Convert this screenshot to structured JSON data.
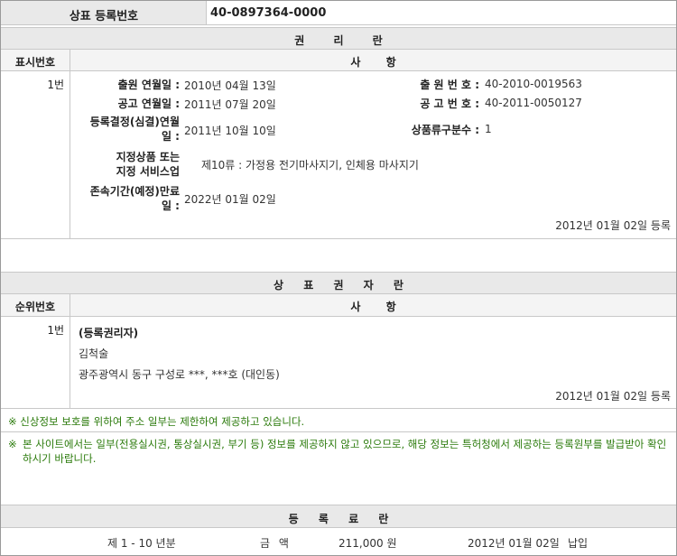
{
  "header": {
    "label": "상표 등록번호",
    "value": "40-0897364-0000"
  },
  "rights": {
    "title": "권 리 란",
    "col_no": "표시번호",
    "col_content": "사 항",
    "row_no": "1번",
    "fields": {
      "app_date_label": "출원 연월일 :",
      "app_date_value": "2010년 04월 13일",
      "app_no_label": "출 원 번 호 :",
      "app_no_value": "40-2010-0019563",
      "pub_date_label": "공고 연월일 :",
      "pub_date_value": "2011년 07월 20일",
      "pub_no_label": "공 고 번 호 :",
      "pub_no_value": "40-2011-0050127",
      "reg_decision_label_1": "등록결정(심결)연월",
      "reg_decision_label_2": "일 :",
      "reg_decision_value": "2011년 10월 10일",
      "class_count_label": "상품류구분수 :",
      "class_count_value": "1",
      "goods_label_1": "지정상품 또는",
      "goods_label_2": "지정 서비스업",
      "goods_value": "제10류 : 가정용 전기마사지기, 인체용 마사지기",
      "expiry_label_1": "존속기간(예정)만료",
      "expiry_label_2": "일 :",
      "expiry_value": "2022년 01월 02일"
    },
    "reg_stamp": "2012년 01월 02일 등록"
  },
  "owner": {
    "title": "상 표 권 자 란",
    "col_no": "순위번호",
    "col_content": "사 항",
    "row_no": "1번",
    "heading": "(등록권리자)",
    "name": "김척술",
    "address": "광주광역시 동구 구성로 ***, ***호 (대인동)",
    "reg_stamp": "2012년 01월 02일 등록"
  },
  "notices": [
    {
      "mark": "※",
      "text": "신상정보 보호를 위하여 주소 일부는 제한하여 제공하고 있습니다."
    },
    {
      "mark": "※",
      "text": "본 사이트에서는 일부(전용실시권, 통상실시권, 부기 등) 정보를 제공하지 않고 있으므로, 해당 정보는 특허청에서 제공하는 등록원부를 발급받아 확인하시기 바랍니다."
    }
  ],
  "fee": {
    "title": "등 록 료 란",
    "period": "제 1 - 10 년분",
    "amount_label": "금 액",
    "amount_value": "211,000 원",
    "paid_date": "2012년 01월 02일",
    "paid_status": "납입"
  }
}
